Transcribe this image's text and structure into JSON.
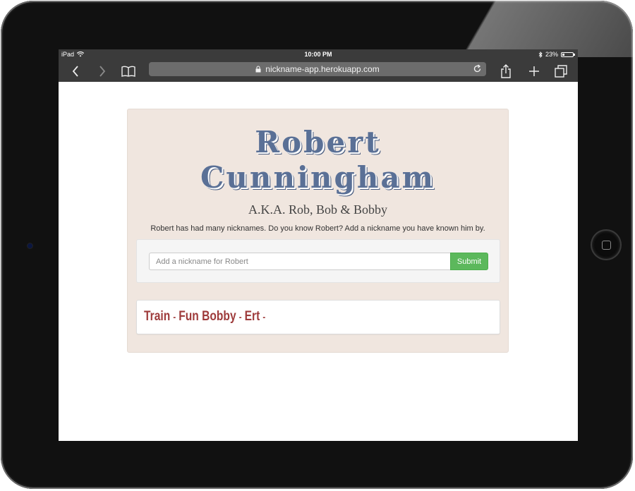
{
  "statusbar": {
    "device": "iPad",
    "time": "10:00 PM",
    "battery": "23%",
    "battery_level": 0.23
  },
  "browser": {
    "url": "nickname-app.herokuapp.com",
    "icons": [
      "back-icon",
      "forward-icon",
      "bookmarks-icon",
      "lock-icon",
      "reload-icon",
      "share-icon",
      "new-tab-icon",
      "tabs-icon"
    ]
  },
  "page": {
    "name_line1": "Robert",
    "name_line2": "Cunningham",
    "aka": "A.K.A. Rob, Bob & Bobby",
    "description": "Robert has had many nicknames. Do you know Robert? Add a nickname you have known him by.",
    "form": {
      "placeholder": "Add a nickname for Robert",
      "value": "",
      "submit_label": "Submit"
    },
    "nicknames": [
      "Train",
      "Fun Bobby",
      "Ert"
    ],
    "separator": "-"
  },
  "colors": {
    "name": "#5a7096",
    "card_bg": "#f0e6df",
    "submit": "#5cb85c",
    "nickname": "#9e3b3b"
  }
}
